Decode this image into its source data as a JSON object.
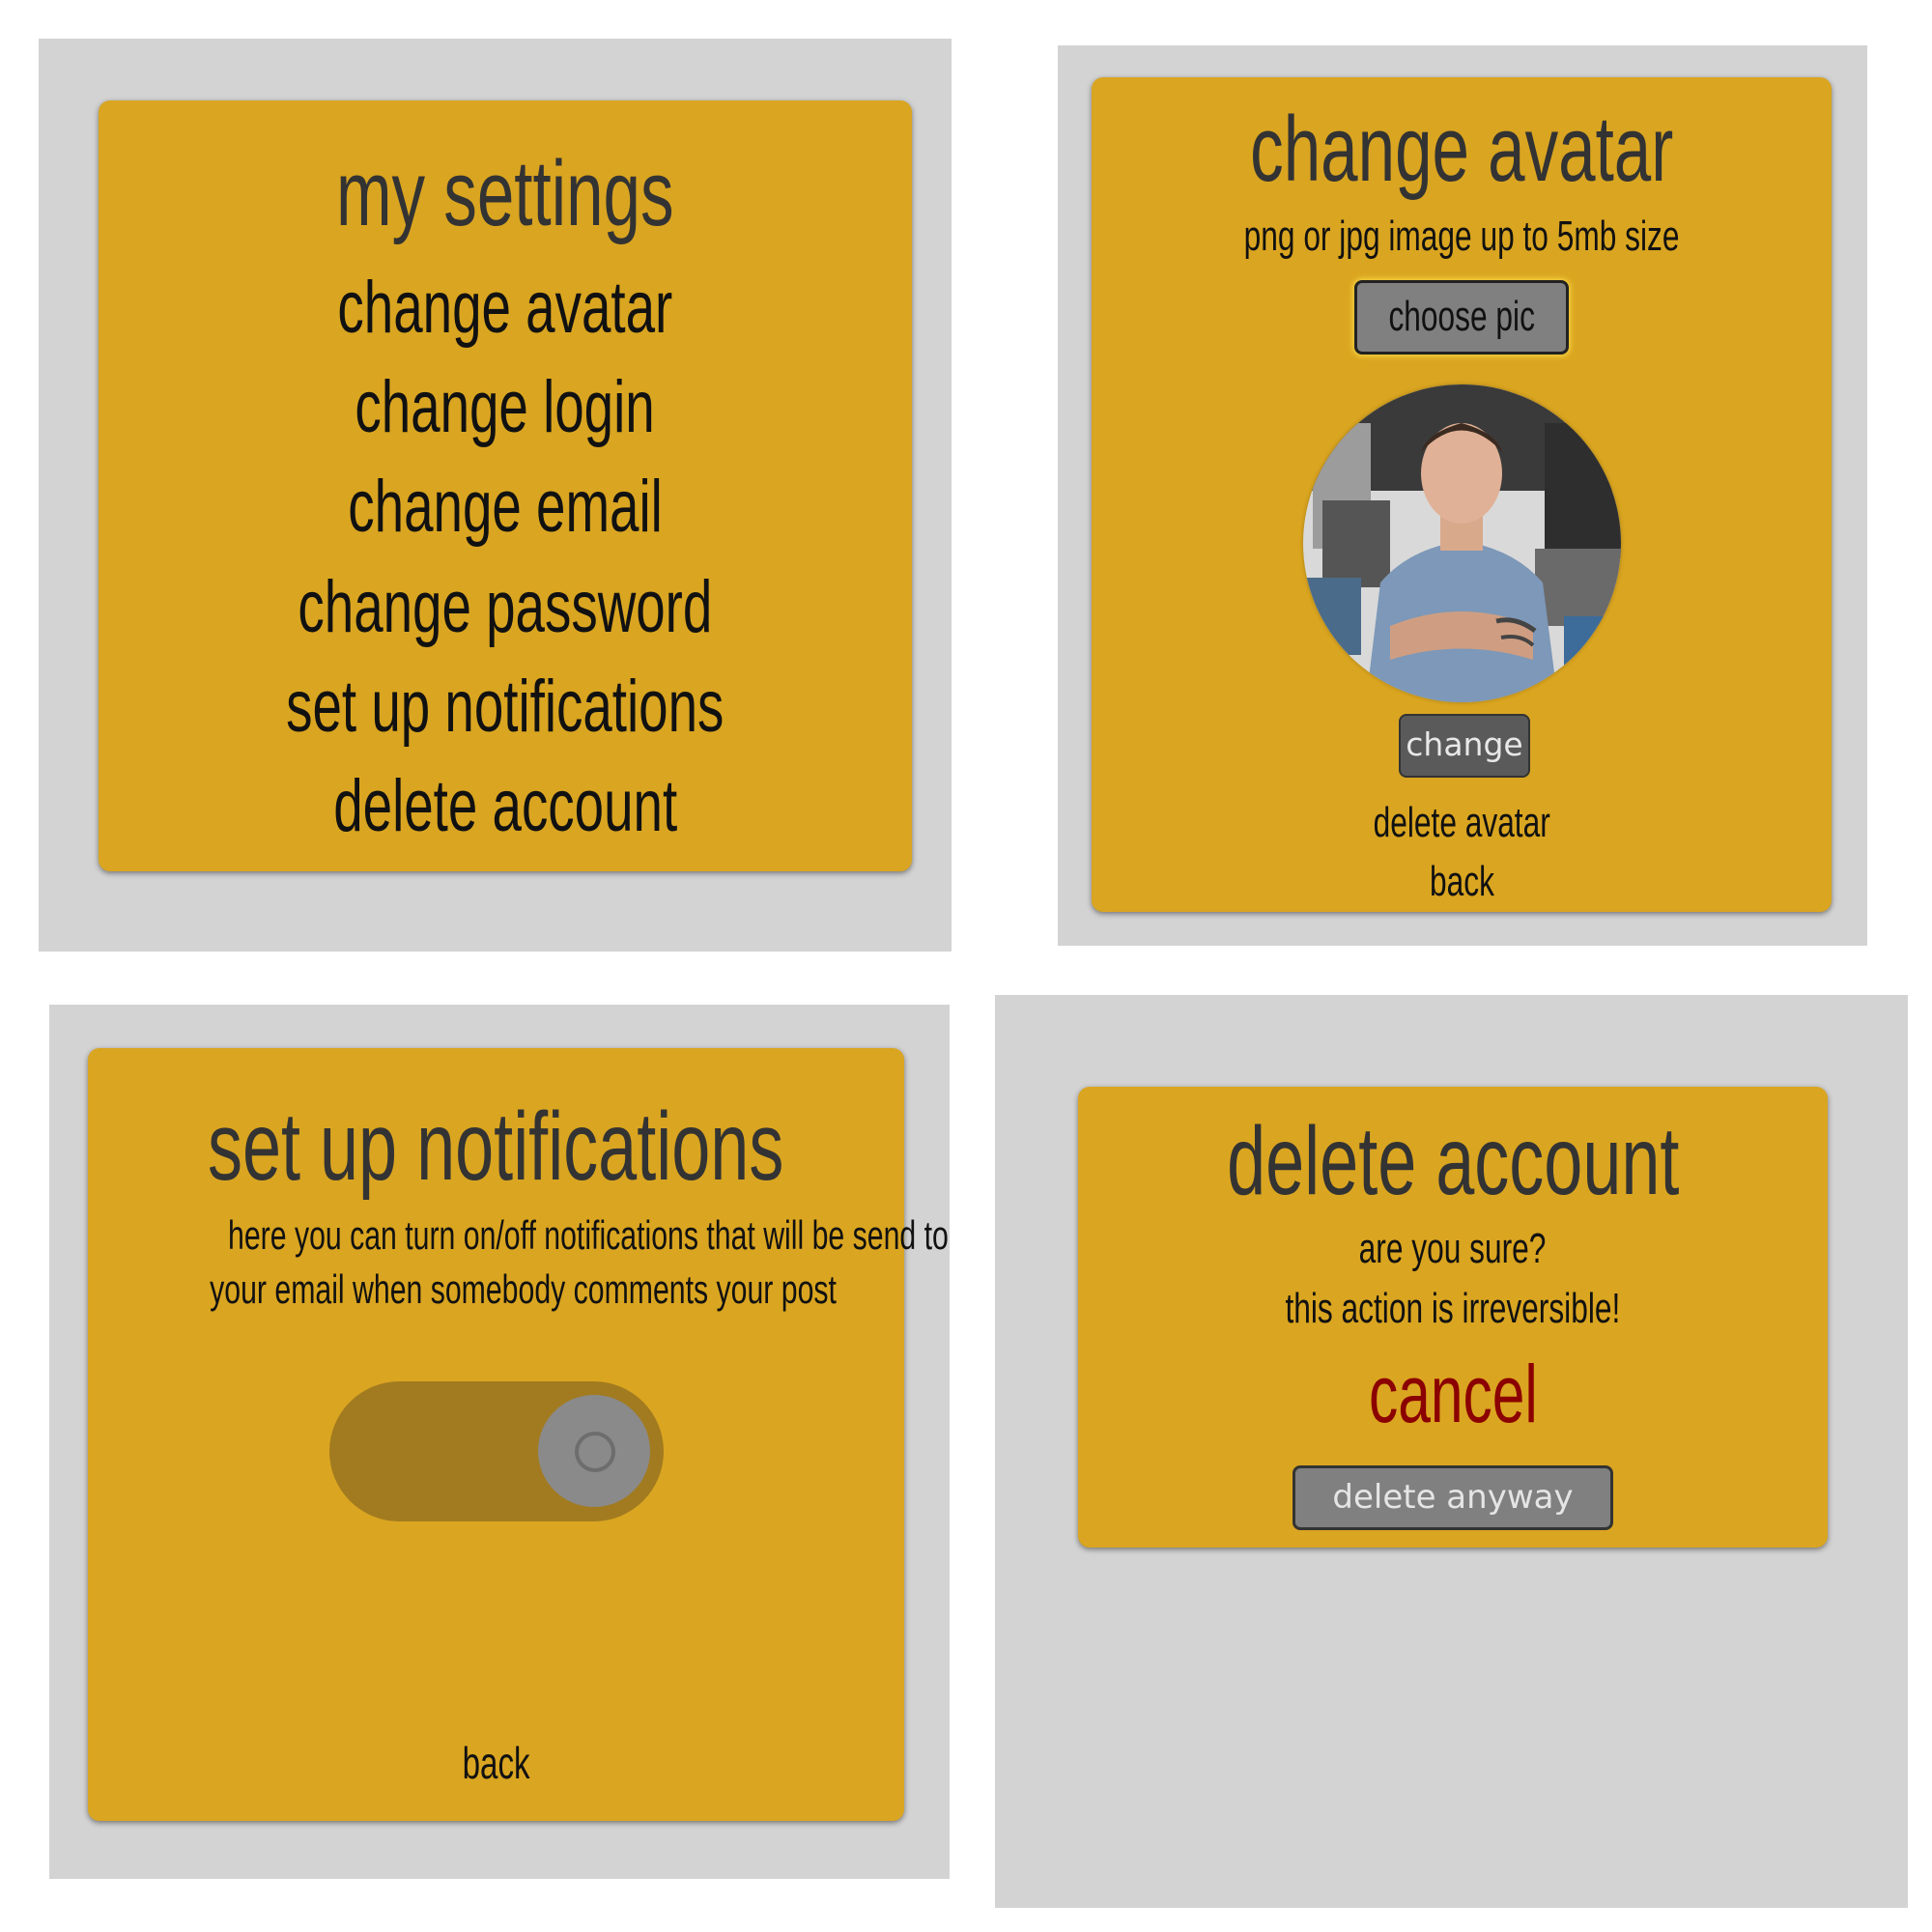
{
  "settings_menu": {
    "title": "my settings",
    "items": [
      {
        "label": "change avatar"
      },
      {
        "label": "change login"
      },
      {
        "label": "change email"
      },
      {
        "label": "change password"
      },
      {
        "label": "set up notifications"
      },
      {
        "label": "delete account"
      }
    ]
  },
  "change_avatar": {
    "title": "change avatar",
    "hint": "png or jpg image up to 5mb size",
    "choose_label": "choose pic",
    "change_label": "change",
    "delete_label": "delete avatar",
    "back_label": "back"
  },
  "notifications": {
    "title": "set up notifications",
    "description_line1": "here you can turn on/off notifications that will be send to",
    "description_line2": "your email when somebody comments your post",
    "toggle_state": "on",
    "back_label": "back"
  },
  "delete_account": {
    "title": "delete account",
    "question": "are you sure?",
    "warning": "this action is irreversible!",
    "cancel_label": "cancel",
    "delete_label": "delete anyway"
  },
  "colors": {
    "panel_bg": "#d3d3d3",
    "card_bg": "#daa520",
    "button_gray": "#808080",
    "cancel_red": "#8b0000",
    "toggle_track": "#a27b20"
  }
}
